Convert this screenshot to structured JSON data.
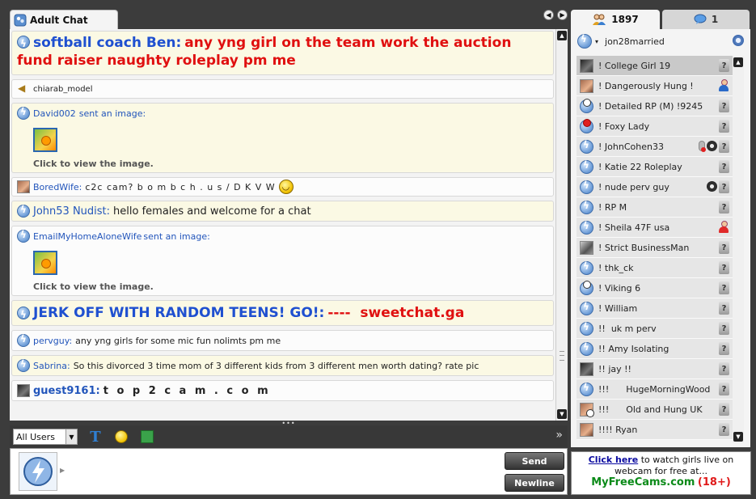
{
  "chat": {
    "tab_title": "Adult Chat",
    "messages": [
      {
        "type": "big",
        "user": "softball coach Ben:",
        "text": "any yng girl on the team work the auction fund raiser naughty roleplay pm me"
      },
      {
        "type": "join",
        "user": "chiarab_model"
      },
      {
        "type": "image",
        "user": "David002",
        "action": "sent an image:",
        "caption": "Click to view the image."
      },
      {
        "type": "normal",
        "user": "BoredWife:",
        "text": "c2c cam?  b o m b c h . u s / D K V W"
      },
      {
        "type": "med",
        "user": "John53 Nudist:",
        "text": "hello females and welcome for a chat"
      },
      {
        "type": "image",
        "user": "EmailMyHomeAloneWife",
        "action": "sent an image:",
        "caption": "Click to view the image."
      },
      {
        "type": "big2",
        "user": "JERK OFF WITH RANDOM TEENS! GO!:",
        "text": "----  sweetchat.ga"
      },
      {
        "type": "normal",
        "user": "pervguy:",
        "text": "any yng girls for some mic fun nolimts pm me"
      },
      {
        "type": "normal",
        "user": "Sabrina:",
        "text": "So this divorced 3 time mom of 3 different kids from 3 different men worth dating?  rate pic"
      },
      {
        "type": "guest",
        "user": "guest9161:",
        "text": "t o p 2 c a m  . c o m"
      }
    ]
  },
  "toolbar": {
    "audience_select": "All Users",
    "splitter_glyph": "•••",
    "more_glyph": "»",
    "text_icon_glyph": "T"
  },
  "input": {
    "send_label": "Send",
    "newline_label": "Newline"
  },
  "user_panel": {
    "tab_users_count": "1897",
    "tab_messages_count": "1",
    "self_name": "jon28married",
    "users": [
      {
        "name": "! College Girl 19",
        "icon": "thumb-dark",
        "badge": "q",
        "selected": true
      },
      {
        "name": "! Dangerously Hung !",
        "icon": "thumb",
        "badge": "male"
      },
      {
        "name": "! Detailed RP (M) !9245",
        "icon": "bubble-clock",
        "badge": "q"
      },
      {
        "name": "! Foxy Lady",
        "icon": "bubble-no",
        "badge": "q"
      },
      {
        "name": "! JohnCohen33",
        "icon": "bubble",
        "badge": "q",
        "cam": true,
        "mic": true
      },
      {
        "name": "! Katie 22 Roleplay",
        "icon": "bubble",
        "badge": "q"
      },
      {
        "name": "! nude perv guy",
        "icon": "bubble",
        "badge": "q",
        "cam": true
      },
      {
        "name": "! RP M",
        "icon": "bubble",
        "badge": "q"
      },
      {
        "name": "! Sheila 47F usa",
        "icon": "bubble",
        "badge": "female"
      },
      {
        "name": "! Strict BusinessMan",
        "icon": "thumb-gray",
        "badge": "q"
      },
      {
        "name": "! thk_ck",
        "icon": "bubble",
        "badge": "q"
      },
      {
        "name": "! Viking 6",
        "icon": "bubble-clock",
        "badge": "q"
      },
      {
        "name": "! William",
        "icon": "bubble",
        "badge": "q"
      },
      {
        "name": "!!  uk m perv",
        "icon": "bubble",
        "badge": "q"
      },
      {
        "name": "!! Amy Isolating",
        "icon": "bubble",
        "badge": "q"
      },
      {
        "name": "!! jay !!",
        "icon": "thumb-dark",
        "badge": "q"
      },
      {
        "name": "!!!      HugeMorningWood",
        "icon": "bubble",
        "badge": "q"
      },
      {
        "name": "!!!      Old and Hung UK",
        "icon": "thumb-clock",
        "badge": "q"
      },
      {
        "name": "!!!! Ryan",
        "icon": "thumb",
        "badge": "q"
      }
    ]
  },
  "promo": {
    "link_text": "Click here",
    "line1_rest": " to watch girls live on",
    "line2": "webcam for free at...",
    "brand": "MyFreeCams.com",
    "age": "(18+)"
  }
}
